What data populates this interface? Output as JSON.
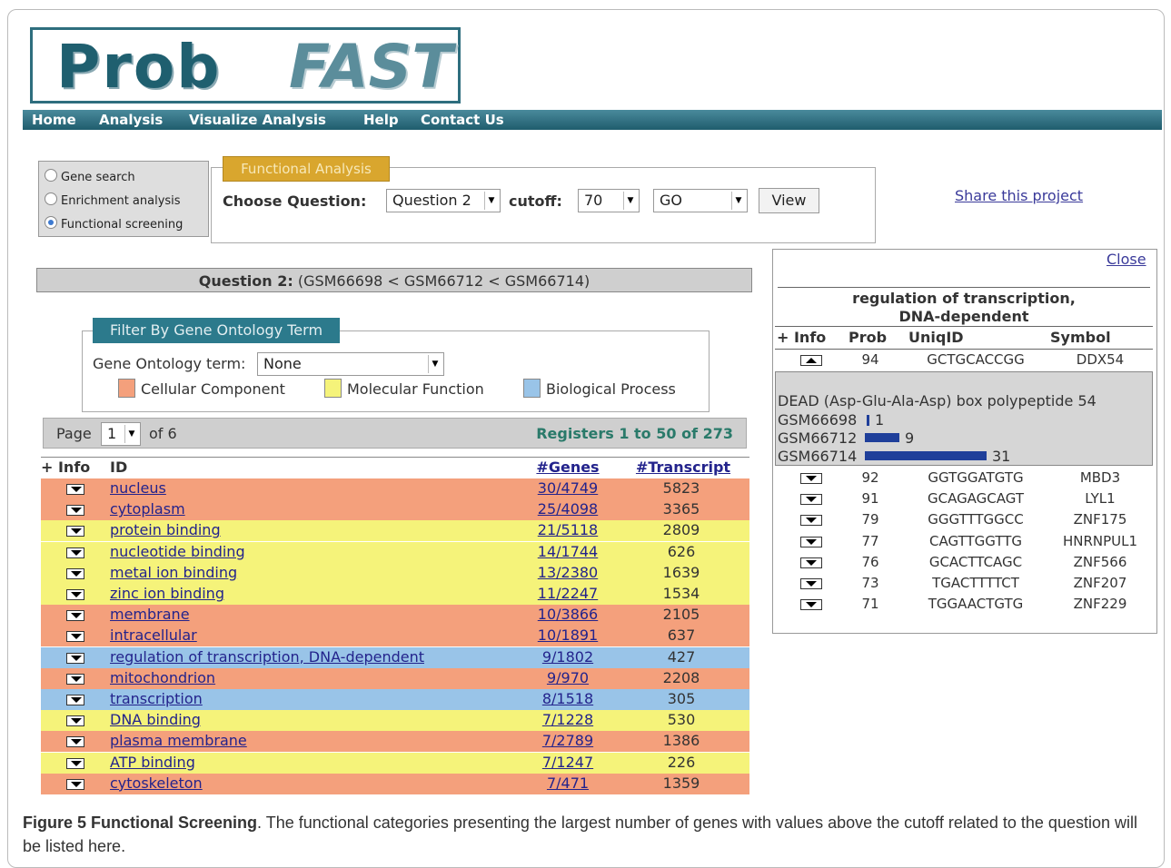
{
  "logo": {
    "prob": "Prob",
    "fast": "FAST"
  },
  "nav": [
    "Home",
    "Analysis",
    "Visualize Analysis",
    "Help",
    "Contact Us"
  ],
  "modes": [
    {
      "label": "Gene search",
      "selected": false
    },
    {
      "label": "Enrichment analysis",
      "selected": false
    },
    {
      "label": "Functional screening",
      "selected": true
    }
  ],
  "functional": {
    "tab": "Functional Analysis",
    "choose_label": "Choose Question:",
    "question": "Question 2",
    "cutoff_label": "cutoff:",
    "cutoff": "70",
    "source": "GO",
    "view": "View"
  },
  "share": "Share this project",
  "question_bar": {
    "bold": "Question 2:",
    "text": " (GSM66698 < GSM66712 < GSM66714)"
  },
  "filter": {
    "tab": "Filter By Gene Ontology Term",
    "term_label": "Gene Ontology term:",
    "term_value": "None",
    "legend": [
      {
        "label": "Cellular Component",
        "color": "#f4a07c"
      },
      {
        "label": "Molecular Function",
        "color": "#f5f37a"
      },
      {
        "label": "Biological Process",
        "color": "#99c4e8"
      }
    ]
  },
  "pager": {
    "page_label": "Page",
    "page": "1",
    "of": "of 6",
    "registers": "Registers 1 to 50 of 273"
  },
  "table": {
    "headers": {
      "info": "+ Info",
      "id": "ID",
      "genes": "#Genes",
      "transcript": "#Transcript"
    },
    "rows": [
      {
        "id": "nucleus",
        "genes": "30/4749",
        "transcript": "5823",
        "color": "#f4a07c"
      },
      {
        "id": "cytoplasm",
        "genes": "25/4098",
        "transcript": "3365",
        "color": "#f4a07c"
      },
      {
        "id": "protein binding",
        "genes": "21/5118",
        "transcript": "2809",
        "color": "#f5f37a"
      },
      {
        "id": "nucleotide binding",
        "genes": "14/1744",
        "transcript": "626",
        "color": "#f5f37a"
      },
      {
        "id": "metal ion binding",
        "genes": "13/2380",
        "transcript": "1639",
        "color": "#f5f37a"
      },
      {
        "id": "zinc ion binding",
        "genes": "11/2247",
        "transcript": "1534",
        "color": "#f5f37a"
      },
      {
        "id": "membrane",
        "genes": "10/3866",
        "transcript": "2105",
        "color": "#f4a07c"
      },
      {
        "id": "intracellular",
        "genes": "10/1891",
        "transcript": "637",
        "color": "#f4a07c"
      },
      {
        "id": "regulation of transcription, DNA-dependent",
        "genes": "9/1802",
        "transcript": "427",
        "color": "#99c4e8"
      },
      {
        "id": "mitochondrion",
        "genes": "9/970",
        "transcript": "2208",
        "color": "#f4a07c"
      },
      {
        "id": "transcription",
        "genes": "8/1518",
        "transcript": "305",
        "color": "#99c4e8"
      },
      {
        "id": "DNA binding",
        "genes": "7/1228",
        "transcript": "530",
        "color": "#f5f37a"
      },
      {
        "id": "plasma membrane",
        "genes": "7/2789",
        "transcript": "1386",
        "color": "#f4a07c"
      },
      {
        "id": "ATP binding",
        "genes": "7/1247",
        "transcript": "226",
        "color": "#f5f37a"
      },
      {
        "id": "cytoskeleton",
        "genes": "7/471",
        "transcript": "1359",
        "color": "#f4a07c"
      }
    ]
  },
  "panel": {
    "close": "Close",
    "title_line1": "regulation of transcription,",
    "title_line2": "DNA-dependent",
    "headers": {
      "info": "+ Info",
      "prob": "Prob",
      "uniq": "UniqID",
      "symbol": "Symbol"
    },
    "first": {
      "prob": "94",
      "uniq": "GCTGCACCGG",
      "symbol": "DDX54"
    },
    "detail": {
      "desc": "DEAD (Asp-Glu-Ala-Asp) box polypeptide 54",
      "samples": [
        {
          "name": "GSM66698",
          "value": "1"
        },
        {
          "name": "GSM66712",
          "value": "9"
        },
        {
          "name": "GSM66714",
          "value": "31"
        }
      ]
    },
    "rows": [
      {
        "prob": "92",
        "uniq": "GGTGGATGTG",
        "symbol": "MBD3"
      },
      {
        "prob": "91",
        "uniq": "GCAGAGCAGT",
        "symbol": "LYL1"
      },
      {
        "prob": "79",
        "uniq": "GGGTTTGGCC",
        "symbol": "ZNF175"
      },
      {
        "prob": "77",
        "uniq": "CAGTTGGTTG",
        "symbol": "HNRNPUL1"
      },
      {
        "prob": "76",
        "uniq": "GCACTTCAGC",
        "symbol": "ZNF566"
      },
      {
        "prob": "73",
        "uniq": "TGACTTTTCT",
        "symbol": "ZNF207"
      },
      {
        "prob": "71",
        "uniq": "TGGAACTGTG",
        "symbol": "ZNF229"
      }
    ]
  },
  "caption": {
    "bold": "Figure 5 Functional Screening",
    "text": ". The functional categories presenting the largest number of genes with values above the cutoff related to the question will be listed here."
  }
}
